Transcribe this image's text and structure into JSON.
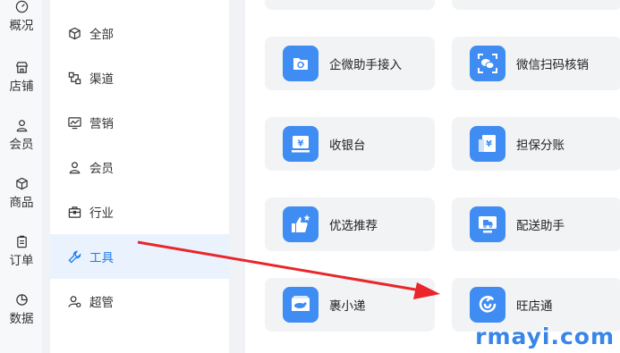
{
  "rail": {
    "items": [
      {
        "label": "概况",
        "icon": "gauge-icon"
      },
      {
        "label": "店铺",
        "icon": "store-icon"
      },
      {
        "label": "会员",
        "icon": "user-icon"
      },
      {
        "label": "商品",
        "icon": "box-icon"
      },
      {
        "label": "订单",
        "icon": "clipboard-icon"
      },
      {
        "label": "数据",
        "icon": "pie-icon"
      }
    ]
  },
  "menu": {
    "items": [
      {
        "label": "全部",
        "icon": "cube-icon"
      },
      {
        "label": "渠道",
        "icon": "channel-icon"
      },
      {
        "label": "营销",
        "icon": "chart-icon"
      },
      {
        "label": "会员",
        "icon": "user-icon"
      },
      {
        "label": "行业",
        "icon": "briefcase-icon"
      },
      {
        "label": "工具",
        "icon": "wrench-icon"
      },
      {
        "label": "超管",
        "icon": "admin-icon"
      }
    ],
    "active": "工具"
  },
  "tools": {
    "cards": [
      {
        "label": "企微助手接入",
        "icon": "wecom-folder-icon"
      },
      {
        "label": "微信扫码核销",
        "icon": "wechat-scan-icon"
      },
      {
        "label": "收银台",
        "icon": "cashier-icon"
      },
      {
        "label": "担保分账",
        "icon": "guarantee-split-icon"
      },
      {
        "label": "优选推荐",
        "icon": "thumbs-up-icon"
      },
      {
        "label": "配送助手",
        "icon": "delivery-icon"
      },
      {
        "label": "裹小递",
        "icon": "parcel-icon"
      },
      {
        "label": "旺店通",
        "icon": "wangdiantong-icon"
      }
    ]
  },
  "watermark": "rmayi.com",
  "colors": {
    "accent": "#1a7cf5",
    "tile": "#3f8cf3",
    "arrow": "#e8262b",
    "active_bg": "#eaf3fd"
  }
}
